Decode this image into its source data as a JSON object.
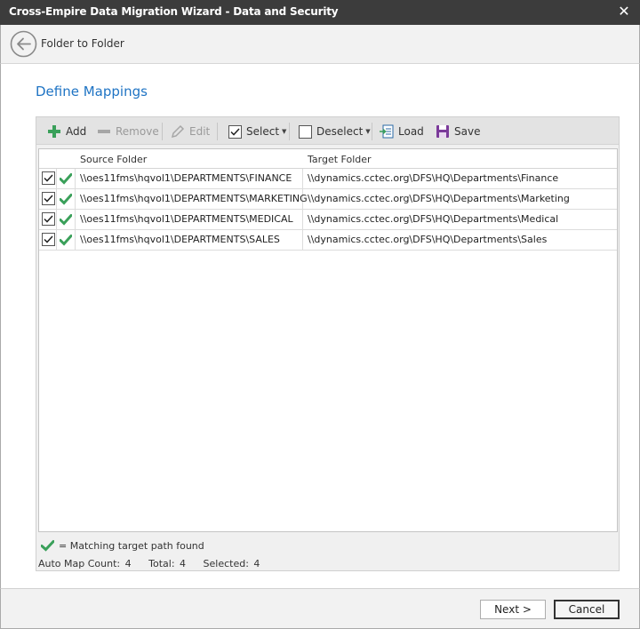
{
  "window": {
    "title": "Cross-Empire Data Migration Wizard  -  Data and Security",
    "close_glyph": "✕"
  },
  "nav": {
    "crumb": "Folder to Folder"
  },
  "page": {
    "heading": "Define Mappings"
  },
  "toolbar": {
    "add": "Add",
    "remove": "Remove",
    "edit": "Edit",
    "select": "Select",
    "deselect": "Deselect",
    "load": "Load",
    "save": "Save"
  },
  "grid": {
    "columns": {
      "source": "Source Folder",
      "target": "Target Folder"
    },
    "rows": [
      {
        "checked": true,
        "matched": true,
        "source": "\\\\oes11fms\\hqvol1\\DEPARTMENTS\\FINANCE",
        "target": "\\\\dynamics.cctec.org\\DFS\\HQ\\Departments\\Finance"
      },
      {
        "checked": true,
        "matched": true,
        "source": "\\\\oes11fms\\hqvol1\\DEPARTMENTS\\MARKETING",
        "target": "\\\\dynamics.cctec.org\\DFS\\HQ\\Departments\\Marketing"
      },
      {
        "checked": true,
        "matched": true,
        "source": "\\\\oes11fms\\hqvol1\\DEPARTMENTS\\MEDICAL",
        "target": "\\\\dynamics.cctec.org\\DFS\\HQ\\Departments\\Medical"
      },
      {
        "checked": true,
        "matched": true,
        "source": "\\\\oes11fms\\hqvol1\\DEPARTMENTS\\SALES",
        "target": "\\\\dynamics.cctec.org\\DFS\\HQ\\Departments\\Sales"
      }
    ]
  },
  "legend": {
    "text": "= Matching target path found"
  },
  "stats": {
    "auto_map_label": "Auto Map Count:",
    "auto_map_value": "4",
    "total_label": "Total:",
    "total_value": "4",
    "selected_label": "Selected:",
    "selected_value": "4"
  },
  "footer": {
    "next": "Next >",
    "cancel": "Cancel"
  },
  "colors": {
    "accent": "#1f74c4",
    "check_green": "#3aa05a",
    "titlebar": "#3c3c3c"
  },
  "icons": {
    "add": "plus-icon",
    "remove": "minus-icon",
    "edit": "pencil-icon",
    "select": "checkbox-checked-icon",
    "deselect": "checkbox-empty-icon",
    "load": "load-icon",
    "save": "floppy-disk-icon",
    "back": "arrow-left-icon",
    "match": "checkmark-icon"
  }
}
